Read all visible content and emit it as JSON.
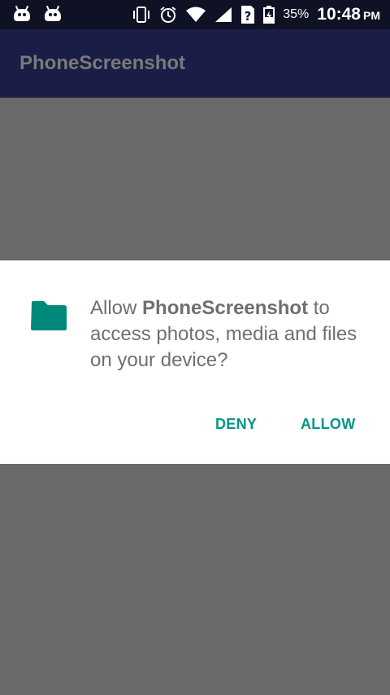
{
  "status_bar": {
    "battery_percent": "35%",
    "time": "10:48",
    "am_pm": "PM"
  },
  "toolbar": {
    "title": "PhoneScreenshot"
  },
  "dialog": {
    "icon": "folder-icon",
    "message_prefix": "Allow ",
    "app_name": "PhoneScreenshot",
    "message_suffix": " to access photos, media and files on your device?",
    "deny_label": "DENY",
    "allow_label": "ALLOW"
  },
  "colors": {
    "accent": "#009688",
    "status_bar_bg": "#0f1124",
    "toolbar_bg": "#1a1e46",
    "scrim": "#6a6a6a"
  }
}
